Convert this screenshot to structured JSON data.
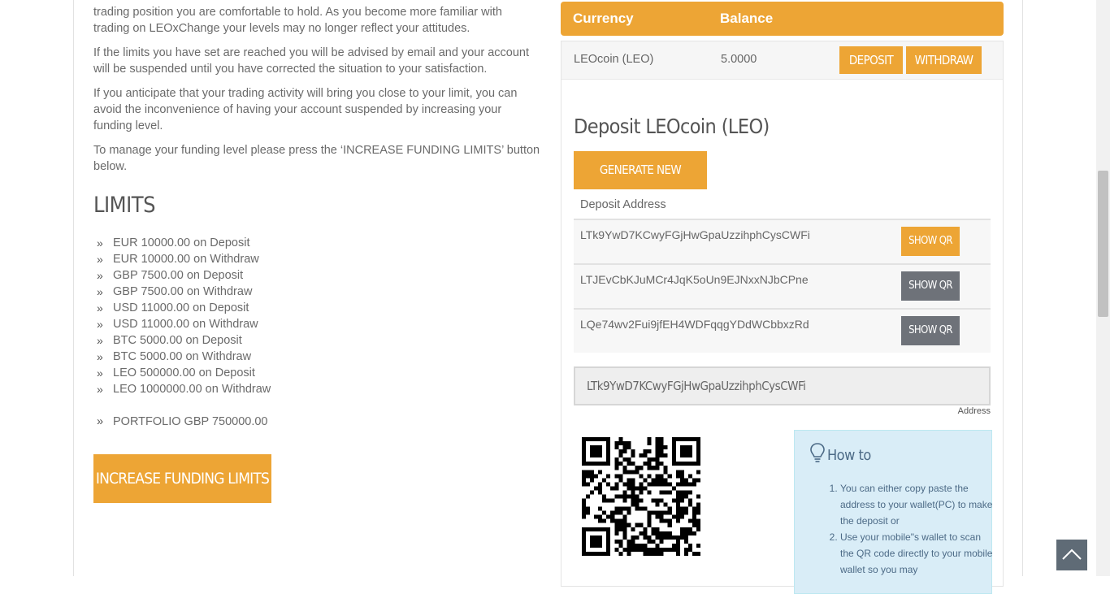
{
  "left": {
    "paragraphs": [
      "trading position you are comfortable to hold. As you become more familiar with trading on LEOxChange your levels may no longer reflect your attitudes.",
      "If the limits you have set are reached you will be advised by email and your account will be suspended until you have corrected the situation to your satisfaction.",
      "If you anticipate that your trading activity will bring you close to your limit, you can avoid the inconvenience of having your account suspended by increasing your funding level.",
      "To manage your funding level please press the ‘INCREASE FUNDING LIMITS’ button below."
    ],
    "limits_title": "LIMITS",
    "limits": [
      "EUR 10000.00 on Deposit",
      "EUR 10000.00 on Withdraw",
      "GBP 7500.00 on Deposit",
      "GBP 7500.00 on Withdraw",
      "USD 11000.00 on Deposit",
      "USD 11000.00 on Withdraw",
      "BTC 5000.00 on Deposit",
      "BTC 5000.00 on Withdraw",
      "LEO 500000.00 on Deposit",
      "LEO 1000000.00 on Withdraw"
    ],
    "portfolio": "PORTFOLIO GBP 750000.00",
    "increase_button": "INCREASE FUNDING LIMITS"
  },
  "balance": {
    "col_currency": "Currency",
    "col_balance": "Balance",
    "row": {
      "currency": "LEOcoin (LEO)",
      "amount": "5.0000",
      "deposit_label": "DEPOSIT",
      "withdraw_label": "WITHDRAW"
    }
  },
  "deposit": {
    "title": "Deposit LEOcoin (LEO)",
    "generate_label": "GENERATE NEW ADDRESS.",
    "address_header": "Deposit Address",
    "addresses": [
      {
        "address": "LTk9YwD7KCwyFGjHwGpaUzzihphCysCWFi",
        "button": "SHOW QR"
      },
      {
        "address": "LTJEvCbKJuMCr4JqK5oUn9EJNxxNJbCPne",
        "button": "SHOW QR"
      },
      {
        "address": "LQe74wv2Fui9jfEH4WDFqqgYDdWCbbxzRd",
        "button": "SHOW QR"
      }
    ],
    "selected_address": "LTk9YwD7KCwyFGjHwGpaUzzihphCysCWFi",
    "address_caption": "Address"
  },
  "howto": {
    "title": "How to",
    "steps": [
      "You can either copy paste the address to your wallet(PC) to make the deposit or",
      "Use your mobile\"s wallet to scan the QR code directly to your mobile wallet so you may"
    ]
  },
  "colors": {
    "accent": "#eda535",
    "gray_button": "#6e7279",
    "info_bg": "#d9edf7"
  },
  "icons": [
    "bulb-icon",
    "chevron-up-icon",
    "qr-code-image"
  ]
}
